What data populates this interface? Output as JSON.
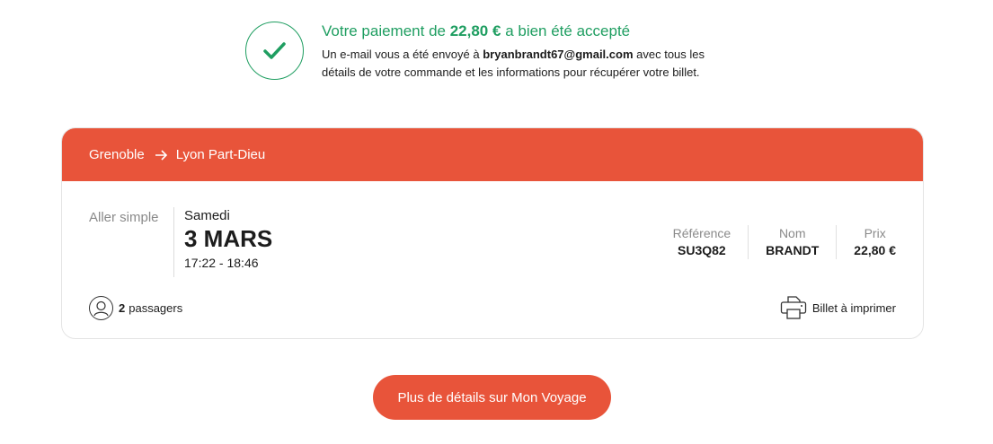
{
  "confirmation": {
    "title_prefix": "Votre paiement de",
    "amount": "22,80 €",
    "title_suffix": "a bien été accepté",
    "desc_prefix": "Un e-mail vous a été envoyé à",
    "email": "bryanbrandt67@gmail.com",
    "desc_suffix_line1": "avec tous les",
    "desc_line2": "détails de votre commande et les informations pour récupérer votre billet.",
    "icon": "check-icon"
  },
  "trip": {
    "origin": "Grenoble",
    "destination": "Lyon Part-Dieu",
    "trip_type": "Aller simple",
    "day": "Samedi",
    "date": "3 MARS",
    "times": "17:22 - 18:46",
    "reference_label": "Référence",
    "reference_value": "SU3Q82",
    "name_label": "Nom",
    "name_value": "BRANDT",
    "price_label": "Prix",
    "price_value": "22,80 €",
    "passengers_count": "2",
    "passengers_label": "passagers",
    "print_label": "Billet à imprimer"
  },
  "cta": {
    "label": "Plus de détails sur Mon Voyage"
  },
  "colors": {
    "brand": "#e8543a",
    "success": "#1f9e61"
  }
}
